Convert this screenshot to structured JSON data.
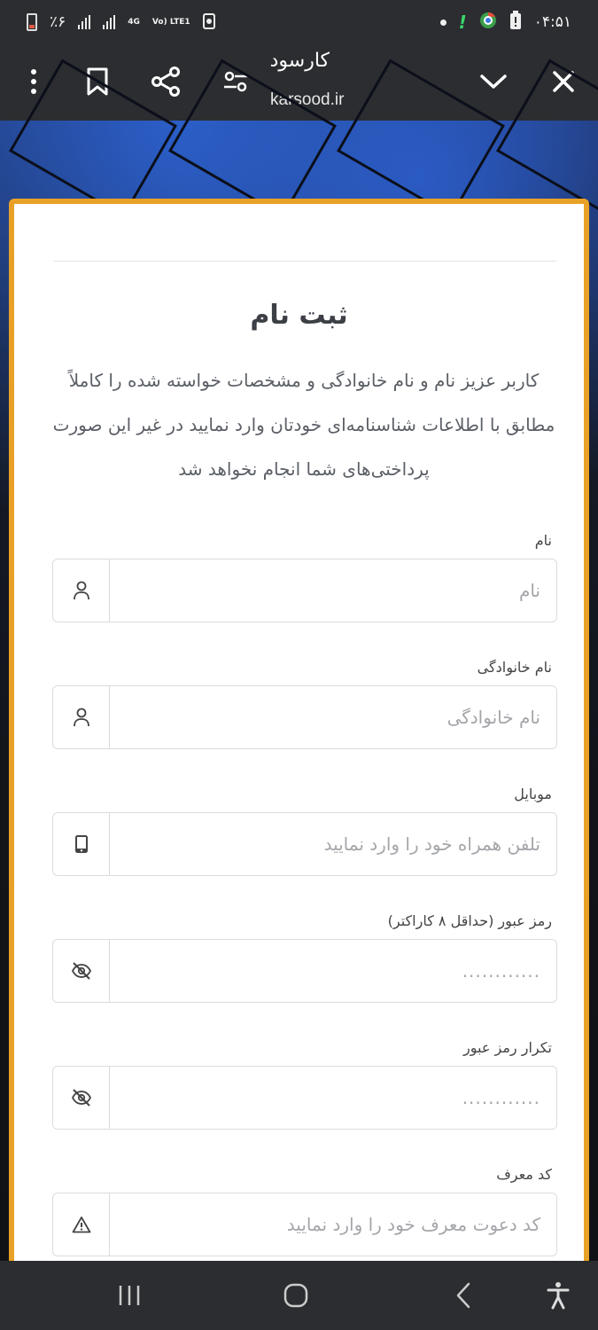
{
  "status_bar": {
    "time": "۰۴:۵۱",
    "battery_percent": "٪۶",
    "network": "4G",
    "volte": "Vo) LTE1",
    "battery_level": 0.06
  },
  "browser": {
    "page_title": "کارسود",
    "url": "karsood.ir",
    "icons": [
      "more-vert-icon",
      "bookmark-icon",
      "share-icon",
      "site-settings-icon",
      "chevron-down-icon",
      "close-icon"
    ]
  },
  "form": {
    "title": "ثبت نام",
    "intro": "کاربر عزیز نام و نام خانوادگی و مشخصات خواسته شده را کاملاً مطابق با اطلاعات شناسنامه‌ای خودتان وارد نمایید در غیر این صورت پرداختی‌های شما انجام نخواهد شد",
    "fields": [
      {
        "label": "نام",
        "placeholder": "نام",
        "icon": "user-icon"
      },
      {
        "label": "نام خانوادگی",
        "placeholder": "نام خانوادگی",
        "icon": "user-icon"
      },
      {
        "label": "موبایل",
        "placeholder": "تلفن همراه خود را وارد نمایید",
        "icon": "mobile-icon"
      },
      {
        "label": "رمز عبور (حداقل ۸ کاراکتر)",
        "placeholder": "............",
        "icon": "eye-off-icon"
      },
      {
        "label": "تکرار رمز عبور",
        "placeholder": "............",
        "icon": "eye-off-icon"
      },
      {
        "label": "کد معرف",
        "placeholder": "کد دعوت معرف خود را وارد نمایید",
        "icon": "warning-icon"
      }
    ]
  },
  "nav": {
    "icons": [
      "recent-apps-icon",
      "home-icon",
      "back-icon",
      "accessibility-icon"
    ]
  }
}
